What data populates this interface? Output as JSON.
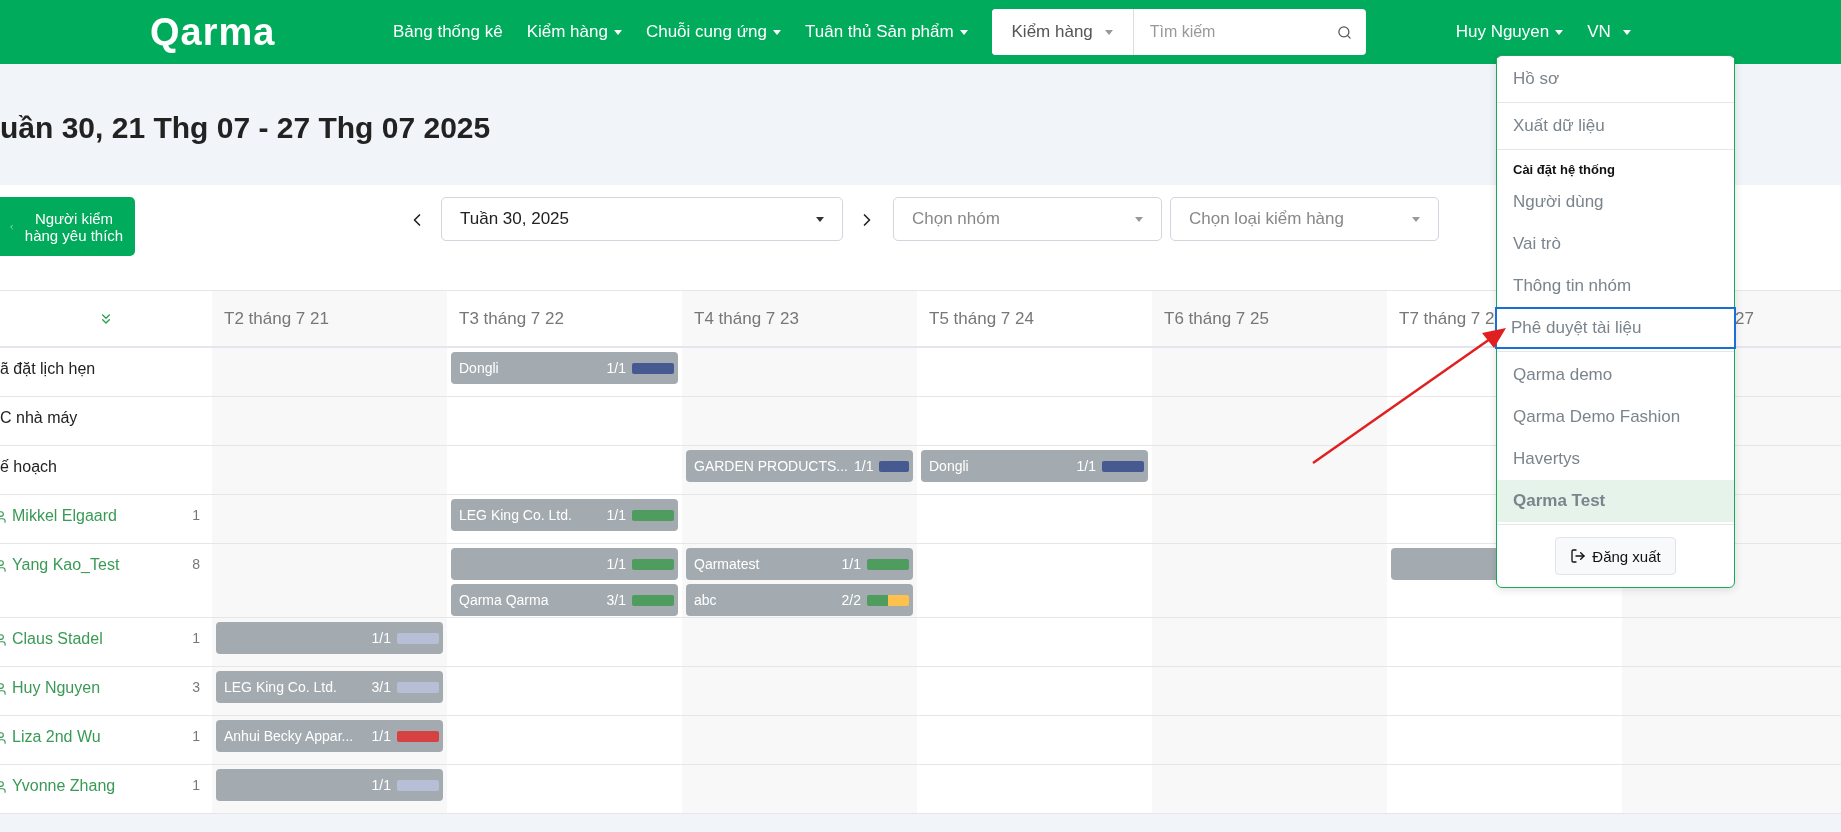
{
  "nav": {
    "logo": "Qarma",
    "menu": [
      {
        "label": "Bảng thống kê",
        "dropdown": false
      },
      {
        "label": "Kiểm hàng",
        "dropdown": true
      },
      {
        "label": "Chuỗi cung ứng",
        "dropdown": true
      },
      {
        "label": "Tuân thủ Sản phẩm",
        "dropdown": true
      }
    ],
    "search": {
      "scope": "Kiểm hàng",
      "placeholder": "Tìm kiếm"
    },
    "user": "Huy Nguyen",
    "language": "VN"
  },
  "page_title": "uần 30, 21 Thg 07 - 27 Thg 07 2025",
  "toolbar": {
    "favorites_button": "Người kiểm hàng yêu thích",
    "week_select": "Tuần 30, 2025",
    "group_select": {
      "placeholder": "Chọn nhóm"
    },
    "type_select": {
      "placeholder": "Chọn loại kiểm hàng"
    }
  },
  "calendar": {
    "columns": [
      {
        "label": "T2 tháng 7 21"
      },
      {
        "label": "T3 tháng 7 22"
      },
      {
        "label": "T4 tháng 7 23"
      },
      {
        "label": "T5 tháng 7 24"
      },
      {
        "label": "T6 tháng 7 25"
      },
      {
        "label": "T7 tháng 7 2"
      },
      {
        "label": "27"
      }
    ],
    "rows": [
      {
        "kind": "status",
        "label": "ã đặt lịch hẹn",
        "cells": [
          [],
          [
            {
              "kind": "event",
              "name": "Dongli",
              "count": "1/1",
              "bar": [
                {
                  "color": "#465a91"
                }
              ]
            }
          ],
          [],
          [],
          [],
          [],
          []
        ]
      },
      {
        "kind": "status",
        "label": "C nhà máy",
        "cells": [
          [],
          [],
          [],
          [],
          [],
          [],
          []
        ]
      },
      {
        "kind": "status",
        "label": "ế hoạch",
        "cells": [
          [],
          [],
          [
            {
              "kind": "event",
              "name": "GARDEN PRODUCTS...",
              "count": "1/1",
              "bar": [
                {
                  "color": "#465a91"
                }
              ]
            }
          ],
          [
            {
              "kind": "event",
              "name": "Dongli",
              "count": "1/1",
              "bar": [
                {
                  "color": "#465a91"
                }
              ]
            }
          ],
          [],
          [],
          []
        ]
      },
      {
        "kind": "inspector",
        "label": "Mikkel Elgaard",
        "count": "1",
        "cells": [
          [],
          [
            {
              "kind": "event",
              "name": "LEG King Co. Ltd.",
              "count": "1/1",
              "bar": [
                {
                  "color": "#4f9c5f"
                }
              ]
            }
          ],
          [],
          [],
          [],
          [],
          []
        ]
      },
      {
        "kind": "inspector",
        "label": "Yang Kao_Test",
        "count": "8",
        "cells": [
          [],
          [
            {
              "kind": "event",
              "count": "1/1",
              "bar": [
                {
                  "color": "#4f9c5f"
                }
              ]
            },
            {
              "kind": "event",
              "name": "Qarma Qarma",
              "count": "3/1",
              "bar": [
                {
                  "color": "#4f9c5f"
                }
              ]
            }
          ],
          [
            {
              "kind": "event",
              "name": "Qarmatest",
              "count": "1/1",
              "bar": [
                {
                  "color": "#4f9c5f"
                }
              ]
            },
            {
              "kind": "event",
              "name": "abc",
              "count": "2/2",
              "bar": [
                {
                  "color": "#4f9c5f"
                },
                {
                  "color": "#ffc14d"
                }
              ]
            }
          ],
          [],
          [],
          [
            {
              "kind": "covered"
            }
          ],
          []
        ]
      },
      {
        "kind": "inspector",
        "label": "Claus Stadel",
        "count": "1",
        "cells": [
          [
            {
              "kind": "event",
              "count": "1/1",
              "bar": [
                {
                  "color": "#b6bfd6"
                }
              ]
            }
          ],
          [],
          [],
          [],
          [],
          [],
          []
        ]
      },
      {
        "kind": "inspector",
        "label": "Huy Nguyen",
        "count": "3",
        "cells": [
          [
            {
              "kind": "event",
              "name": "LEG King Co. Ltd.",
              "count": "3/1",
              "bar": [
                {
                  "color": "#b6bfd6"
                }
              ]
            }
          ],
          [],
          [],
          [],
          [],
          [],
          []
        ]
      },
      {
        "kind": "inspector",
        "label": "Liza 2nd Wu",
        "count": "1",
        "cells": [
          [
            {
              "kind": "event",
              "name": "Anhui Becky Appar...",
              "count": "1/1",
              "bar": [
                {
                  "color": "#d64141"
                }
              ]
            }
          ],
          [],
          [],
          [],
          [],
          [],
          []
        ]
      },
      {
        "kind": "inspector",
        "label": "Yvonne Zhang",
        "count": "1",
        "cells": [
          [
            {
              "kind": "event",
              "count": "1/1",
              "bar": [
                {
                  "color": "#b6bfd6"
                }
              ]
            }
          ],
          [],
          [],
          [],
          [],
          [],
          []
        ]
      }
    ]
  },
  "user_menu": {
    "groups": [
      {
        "items": [
          {
            "label": "Hồ sơ",
            "outlined": false
          }
        ]
      },
      {
        "items": [
          {
            "label": "Xuất dữ liệu",
            "outlined": false
          }
        ]
      },
      {
        "title": "Cài đặt hệ thống",
        "items": [
          {
            "label": "Người dùng",
            "outlined": false
          },
          {
            "label": "Vai trò",
            "outlined": false
          },
          {
            "label": "Thông tin nhóm",
            "outlined": false
          },
          {
            "label": "Phê duyệt tài liệu",
            "outlined": true
          }
        ]
      },
      {
        "items": [
          {
            "label": "Qarma demo",
            "outlined": false,
            "selected": false
          },
          {
            "label": "Qarma Demo Fashion",
            "outlined": false,
            "selected": false
          },
          {
            "label": "Havertys",
            "outlined": false,
            "selected": false
          },
          {
            "label": "Qarma Test",
            "outlined": false,
            "selected": true
          }
        ]
      }
    ],
    "logout": "Đăng xuất"
  }
}
